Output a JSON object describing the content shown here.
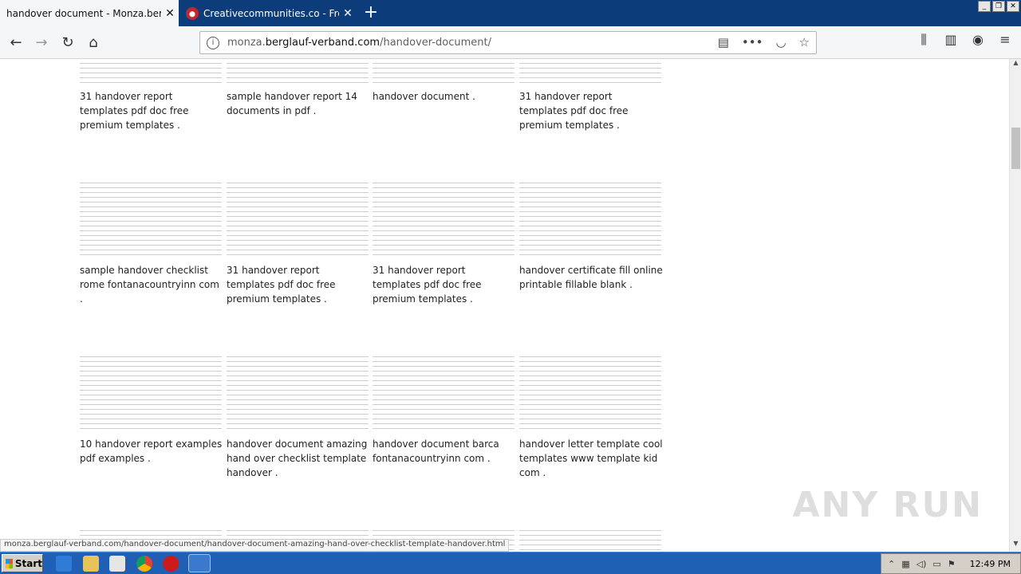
{
  "browser": {
    "tabs": [
      {
        "title": "handover document - Monza.berglauf-",
        "active": true
      },
      {
        "title": "Creativecommunities.co - Free All",
        "active": false
      }
    ],
    "url": {
      "prefix": "monza.",
      "domain": "berglauf-verband.com",
      "path": "/handover-document/"
    },
    "status_url": "monza.berglauf-verband.com/handover-document/handover-document-amazing-hand-over-checklist-template-handover.html"
  },
  "icons": {
    "back": "back-arrow-icon",
    "forward": "forward-arrow-icon",
    "reload": "reload-icon",
    "home": "home-icon",
    "info": "info-icon",
    "reader": "reader-view-icon",
    "more": "more-icon",
    "pocket": "pocket-icon",
    "bookmark": "bookmark-star-icon",
    "library": "library-icon",
    "sidebar": "sidebar-icon",
    "account": "account-icon",
    "menu": "hamburger-menu-icon"
  },
  "gallery": [
    {
      "caption": "31 handover report templates pdf doc free premium templates ."
    },
    {
      "caption": "sample handover report 14 documents in pdf ."
    },
    {
      "caption": "handover document ."
    },
    {
      "caption": "31 handover report templates pdf doc free premium templates ."
    },
    {
      "caption": "sample handover checklist rome fontanacountryinn com ."
    },
    {
      "caption": "31 handover report templates pdf doc free premium templates ."
    },
    {
      "caption": "31 handover report templates pdf doc free premium templates ."
    },
    {
      "caption": "handover certificate fill online printable fillable blank ."
    },
    {
      "caption": "10 handover report examples pdf examples ."
    },
    {
      "caption": "handover document amazing hand over checklist template handover ."
    },
    {
      "caption": "handover document barca fontanacountryinn com ."
    },
    {
      "caption": "handover letter template cool templates www template kid com ."
    }
  ],
  "watermark": "ANY RUN",
  "taskbar": {
    "start_label": "Start",
    "clock": "12:49 PM"
  }
}
